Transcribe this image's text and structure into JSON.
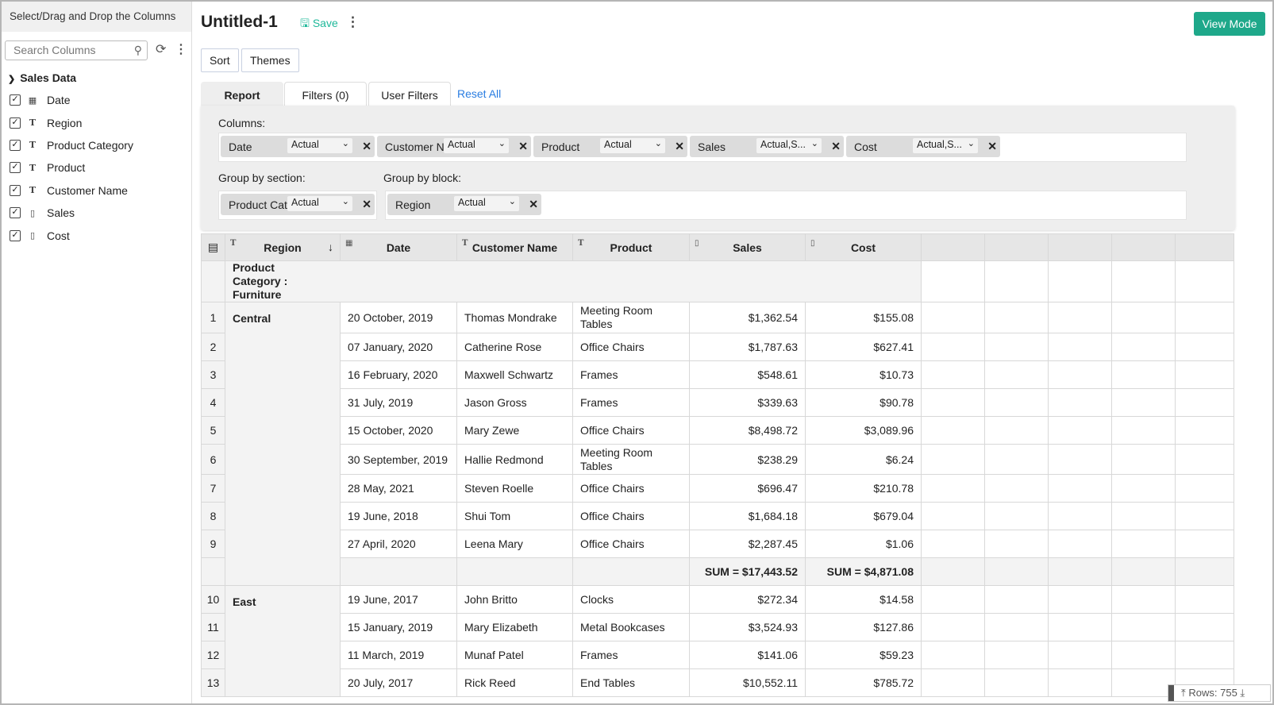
{
  "sidebar": {
    "header": "Select/Drag and Drop the Columns",
    "search_placeholder": "Search Columns",
    "table_name": "Sales Data",
    "fields": [
      {
        "label": "Date",
        "type": "date"
      },
      {
        "label": "Region",
        "type": "text"
      },
      {
        "label": "Product Category",
        "type": "text"
      },
      {
        "label": "Product",
        "type": "text"
      },
      {
        "label": "Customer Name",
        "type": "text"
      },
      {
        "label": "Sales",
        "type": "currency"
      },
      {
        "label": "Cost",
        "type": "currency"
      }
    ]
  },
  "header": {
    "title": "Untitled-1",
    "save": "Save",
    "view_mode": "View Mode"
  },
  "toolbar": {
    "sort": "Sort",
    "themes": "Themes"
  },
  "tabs": {
    "report": "Report",
    "filters": "Filters (0)",
    "user_filters": "User Filters",
    "reset_all": "Reset All"
  },
  "panel": {
    "columns_label": "Columns:",
    "group_section_label": "Group by section:",
    "group_block_label": "Group by block:",
    "columns": [
      {
        "name": "Date",
        "agg": "Actual"
      },
      {
        "name": "Customer N...",
        "agg": "Actual"
      },
      {
        "name": "Product",
        "agg": "Actual"
      },
      {
        "name": "Sales",
        "agg": "Actual,S..."
      },
      {
        "name": "Cost",
        "agg": "Actual,S..."
      }
    ],
    "group_section": [
      {
        "name": "Product Cat...",
        "agg": "Actual"
      }
    ],
    "group_block": [
      {
        "name": "Region",
        "agg": "Actual"
      }
    ]
  },
  "grid": {
    "headers": [
      "Region",
      "Date",
      "Customer Name",
      "Product",
      "Sales",
      "Cost"
    ],
    "section_label": "Product Category : Furniture",
    "groups": [
      {
        "region": "Central",
        "rows": [
          [
            "1",
            "20 October, 2019",
            "Thomas Mondrake",
            "Meeting Room Tables",
            "$1,362.54",
            "$155.08"
          ],
          [
            "2",
            "07 January, 2020",
            "Catherine Rose",
            "Office Chairs",
            "$1,787.63",
            "$627.41"
          ],
          [
            "3",
            "16 February, 2020",
            "Maxwell Schwartz",
            "Frames",
            "$548.61",
            "$10.73"
          ],
          [
            "4",
            "31 July, 2019",
            "Jason Gross",
            "Frames",
            "$339.63",
            "$90.78"
          ],
          [
            "5",
            "15 October, 2020",
            "Mary Zewe",
            "Office Chairs",
            "$8,498.72",
            "$3,089.96"
          ],
          [
            "6",
            "30 September, 2019",
            "Hallie Redmond",
            "Meeting Room Tables",
            "$238.29",
            "$6.24"
          ],
          [
            "7",
            "28 May, 2021",
            "Steven Roelle",
            "Office Chairs",
            "$696.47",
            "$210.78"
          ],
          [
            "8",
            "19 June, 2018",
            "Shui Tom",
            "Office Chairs",
            "$1,684.18",
            "$679.04"
          ],
          [
            "9",
            "27 April, 2020",
            "Leena Mary",
            "Office Chairs",
            "$2,287.45",
            "$1.06"
          ]
        ],
        "sum_sales": "SUM = $17,443.52",
        "sum_cost": "SUM = $4,871.08"
      },
      {
        "region": "East",
        "rows": [
          [
            "10",
            "19 June, 2017",
            "John Britto",
            "Clocks",
            "$272.34",
            "$14.58"
          ],
          [
            "11",
            "15 January, 2019",
            "Mary Elizabeth",
            "Metal Bookcases",
            "$3,524.93",
            "$127.86"
          ],
          [
            "12",
            "11 March, 2019",
            "Munaf Patel",
            "Frames",
            "$141.06",
            "$59.23"
          ],
          [
            "13",
            "20 July, 2017",
            "Rick Reed",
            "End Tables",
            "$10,552.11",
            "$785.72"
          ]
        ]
      }
    ]
  },
  "footer": {
    "rows": "Rows: 755"
  }
}
